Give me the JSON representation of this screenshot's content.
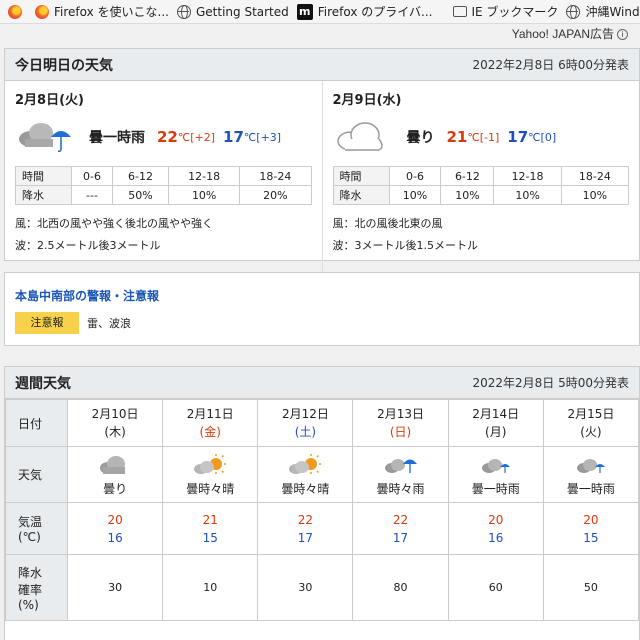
{
  "bookmarks": [
    {
      "label": "",
      "icon": "firefox-icon"
    },
    {
      "label": "Firefox を使いこな...",
      "icon": "firefox-icon"
    },
    {
      "label": "Getting Started",
      "icon": "globe-icon"
    },
    {
      "label": "Firefox のプライバ...",
      "icon": "mozilla-m-icon"
    },
    {
      "label": "IE ブックマーク",
      "icon": "folder-icon"
    },
    {
      "label": "沖縄WindGURU: J",
      "icon": "globe-icon"
    }
  ],
  "ad_label": "Yahoo! JAPAN広告",
  "today": {
    "title": "今日明日の天気",
    "issued": "2022年2月8日 6時00分発表",
    "time_labels": [
      "時間",
      "0-6",
      "6-12",
      "12-18",
      "18-24"
    ],
    "rain_label": "降水",
    "days": [
      {
        "date": "2月8日(火)",
        "weather": "曇一時雨",
        "icon": "cloud-rain-icon",
        "high": "22",
        "high_unit": "℃",
        "high_diff": "[+2]",
        "low": "17",
        "low_unit": "℃",
        "low_diff": "[+3]",
        "rain": [
          "---",
          "50%",
          "10%",
          "20%"
        ],
        "wind": "風：北西の風やや強く後北の風やや強く",
        "wave": "波：2.5メートル後3メートル"
      },
      {
        "date": "2月9日(水)",
        "weather": "曇り",
        "icon": "cloud-icon",
        "high": "21",
        "high_unit": "℃",
        "high_diff": "[-1]",
        "low": "17",
        "low_unit": "℃",
        "low_diff": "[0]",
        "rain": [
          "10%",
          "10%",
          "10%",
          "10%"
        ],
        "wind": "風：北の風後北東の風",
        "wave": "波：3メートル後1.5メートル"
      }
    ]
  },
  "warnings": {
    "title": "本島中南部の警報・注意報",
    "badge": "注意報",
    "text": "雷、波浪"
  },
  "weekly": {
    "title": "週間天気",
    "issued": "2022年2月8日 5時00分発表",
    "row_labels": {
      "date": "日付",
      "weather": "天気",
      "temp_line1": "気温",
      "temp_line2": "(℃)",
      "prob_line1": "降水",
      "prob_line2": "確率",
      "prob_line3": "(%)"
    },
    "days": [
      {
        "date": "2月10日",
        "dow": "(木)",
        "dow_class": "",
        "icon": "cloud-icon",
        "weather": "曇り",
        "high": "20",
        "low": "16",
        "prob": "30"
      },
      {
        "date": "2月11日",
        "dow": "(金)",
        "dow_class": "dow-fri",
        "icon": "cloud-sun-icon",
        "weather": "曇時々晴",
        "high": "21",
        "low": "15",
        "prob": "10"
      },
      {
        "date": "2月12日",
        "dow": "(土)",
        "dow_class": "dow-sat",
        "icon": "cloud-sun-icon",
        "weather": "曇時々晴",
        "high": "22",
        "low": "17",
        "prob": "30"
      },
      {
        "date": "2月13日",
        "dow": "(日)",
        "dow_class": "dow-sun",
        "icon": "cloud-rain-icon",
        "weather": "曇時々雨",
        "high": "22",
        "low": "17",
        "prob": "80"
      },
      {
        "date": "2月14日",
        "dow": "(月)",
        "dow_class": "",
        "icon": "cloud-rain-icon",
        "weather": "曇一時雨",
        "high": "20",
        "low": "16",
        "prob": "60"
      },
      {
        "date": "2月15日",
        "dow": "(火)",
        "dow_class": "",
        "icon": "cloud-rain-icon",
        "weather": "曇一時雨",
        "high": "20",
        "low": "15",
        "prob": "50"
      }
    ]
  }
}
